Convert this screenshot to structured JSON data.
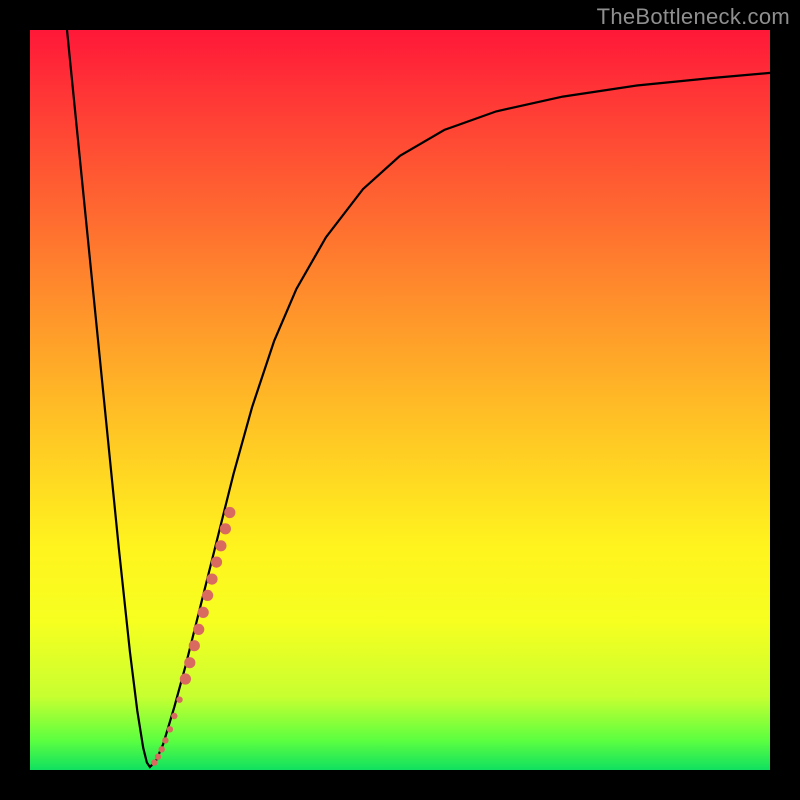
{
  "watermark": "TheBottleneck.com",
  "chart_data": {
    "type": "line",
    "title": "",
    "xlabel": "",
    "ylabel": "",
    "xlim": [
      0,
      100
    ],
    "ylim": [
      0,
      100
    ],
    "gradient_stops": [
      {
        "pos": 0,
        "color": "#ff1838"
      },
      {
        "pos": 10,
        "color": "#ff3a36"
      },
      {
        "pos": 25,
        "color": "#ff6a30"
      },
      {
        "pos": 40,
        "color": "#ff9a2a"
      },
      {
        "pos": 55,
        "color": "#ffc824"
      },
      {
        "pos": 70,
        "color": "#fff41e"
      },
      {
        "pos": 80,
        "color": "#f6ff20"
      },
      {
        "pos": 90,
        "color": "#c8ff30"
      },
      {
        "pos": 96,
        "color": "#5cff40"
      },
      {
        "pos": 100,
        "color": "#10e060"
      }
    ],
    "series": [
      {
        "name": "bottleneck-curve",
        "color": "#000000",
        "points": [
          {
            "x": 5.0,
            "y": 100.0
          },
          {
            "x": 6.0,
            "y": 90.0
          },
          {
            "x": 7.5,
            "y": 75.0
          },
          {
            "x": 9.0,
            "y": 60.0
          },
          {
            "x": 10.5,
            "y": 45.0
          },
          {
            "x": 12.0,
            "y": 30.0
          },
          {
            "x": 13.5,
            "y": 16.0
          },
          {
            "x": 14.5,
            "y": 8.0
          },
          {
            "x": 15.3,
            "y": 3.0
          },
          {
            "x": 15.8,
            "y": 1.0
          },
          {
            "x": 16.2,
            "y": 0.4
          },
          {
            "x": 17.0,
            "y": 1.2
          },
          {
            "x": 18.0,
            "y": 3.5
          },
          {
            "x": 19.5,
            "y": 8.5
          },
          {
            "x": 21.0,
            "y": 14.0
          },
          {
            "x": 23.0,
            "y": 22.0
          },
          {
            "x": 25.0,
            "y": 30.0
          },
          {
            "x": 27.5,
            "y": 40.0
          },
          {
            "x": 30.0,
            "y": 49.0
          },
          {
            "x": 33.0,
            "y": 58.0
          },
          {
            "x": 36.0,
            "y": 65.0
          },
          {
            "x": 40.0,
            "y": 72.0
          },
          {
            "x": 45.0,
            "y": 78.5
          },
          {
            "x": 50.0,
            "y": 83.0
          },
          {
            "x": 56.0,
            "y": 86.5
          },
          {
            "x": 63.0,
            "y": 89.0
          },
          {
            "x": 72.0,
            "y": 91.0
          },
          {
            "x": 82.0,
            "y": 92.5
          },
          {
            "x": 92.0,
            "y": 93.5
          },
          {
            "x": 100.0,
            "y": 94.2
          }
        ]
      },
      {
        "name": "highlight-dots",
        "color": "#d86a60",
        "radius_small": 3.2,
        "radius_large": 5.6,
        "points": [
          {
            "x": 16.8,
            "y": 1.0,
            "r": "small"
          },
          {
            "x": 17.3,
            "y": 1.8,
            "r": "small"
          },
          {
            "x": 17.8,
            "y": 2.8,
            "r": "small"
          },
          {
            "x": 18.3,
            "y": 4.0,
            "r": "small"
          },
          {
            "x": 18.9,
            "y": 5.5,
            "r": "small"
          },
          {
            "x": 19.5,
            "y": 7.3,
            "r": "small"
          },
          {
            "x": 20.2,
            "y": 9.5,
            "r": "small"
          },
          {
            "x": 21.0,
            "y": 12.3,
            "r": "large"
          },
          {
            "x": 21.6,
            "y": 14.5,
            "r": "large"
          },
          {
            "x": 22.2,
            "y": 16.8,
            "r": "large"
          },
          {
            "x": 22.8,
            "y": 19.0,
            "r": "large"
          },
          {
            "x": 23.4,
            "y": 21.3,
            "r": "large"
          },
          {
            "x": 24.0,
            "y": 23.6,
            "r": "large"
          },
          {
            "x": 24.6,
            "y": 25.8,
            "r": "large"
          },
          {
            "x": 25.2,
            "y": 28.1,
            "r": "large"
          },
          {
            "x": 25.8,
            "y": 30.3,
            "r": "large"
          },
          {
            "x": 26.4,
            "y": 32.6,
            "r": "large"
          },
          {
            "x": 27.0,
            "y": 34.8,
            "r": "large"
          }
        ]
      }
    ]
  }
}
